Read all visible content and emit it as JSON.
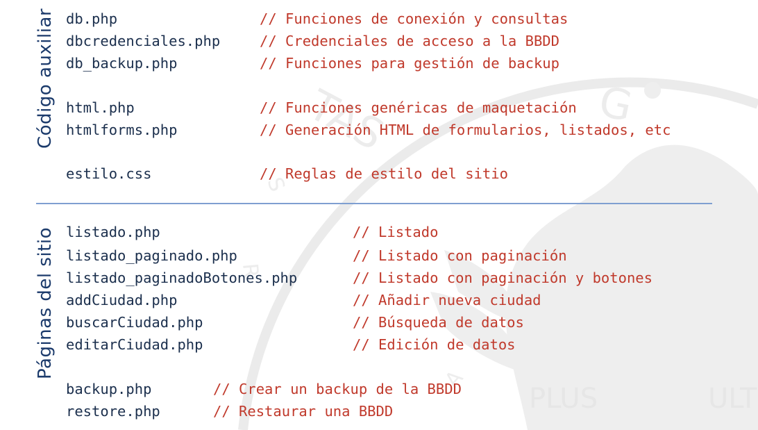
{
  "aux_section": {
    "label": "Código auxiliar",
    "files": [
      {
        "name": "db.php",
        "comment": "// Funciones de conexión y consultas"
      },
      {
        "name": "dbcredenciales.php",
        "comment": "// Credenciales de acceso a la BBDD"
      },
      {
        "name": "db_backup.php",
        "comment": "// Funciones para gestión de backup"
      },
      {
        "name": "html.php",
        "comment": "// Funciones genéricas de maquetación"
      },
      {
        "name": "htmlforms.php",
        "comment": "// Generación HTML de formularios, listados, etc"
      },
      {
        "name": "estilo.css",
        "comment": "// Reglas de estilo del sitio"
      }
    ]
  },
  "pages_section": {
    "label": "Páginas del sitio",
    "files": [
      {
        "name": "listado.php",
        "comment": "// Listado"
      },
      {
        "name": "listado_paginado.php",
        "comment": "// Listado con paginación"
      },
      {
        "name": "listado_paginadoBotones.php",
        "comment": "// Listado con paginación y botones"
      },
      {
        "name": "addCiudad.php",
        "comment": "// Añadir nueva ciudad"
      },
      {
        "name": "buscarCiudad.php",
        "comment": "// Búsqueda de datos"
      },
      {
        "name": "editarCiudad.php",
        "comment": "// Edición de datos"
      },
      {
        "name": "backup.php",
        "comment": "// Crear un backup de la BBDD"
      },
      {
        "name": "restore.php",
        "comment": "// Restaurar una BBDD"
      }
    ]
  },
  "watermark": {
    "text_left": "PLUS",
    "text_right": "ULTRA",
    "text_arc": "TAS    G",
    "icon": "university-eagle-seal-icon",
    "color": "#ececec"
  }
}
